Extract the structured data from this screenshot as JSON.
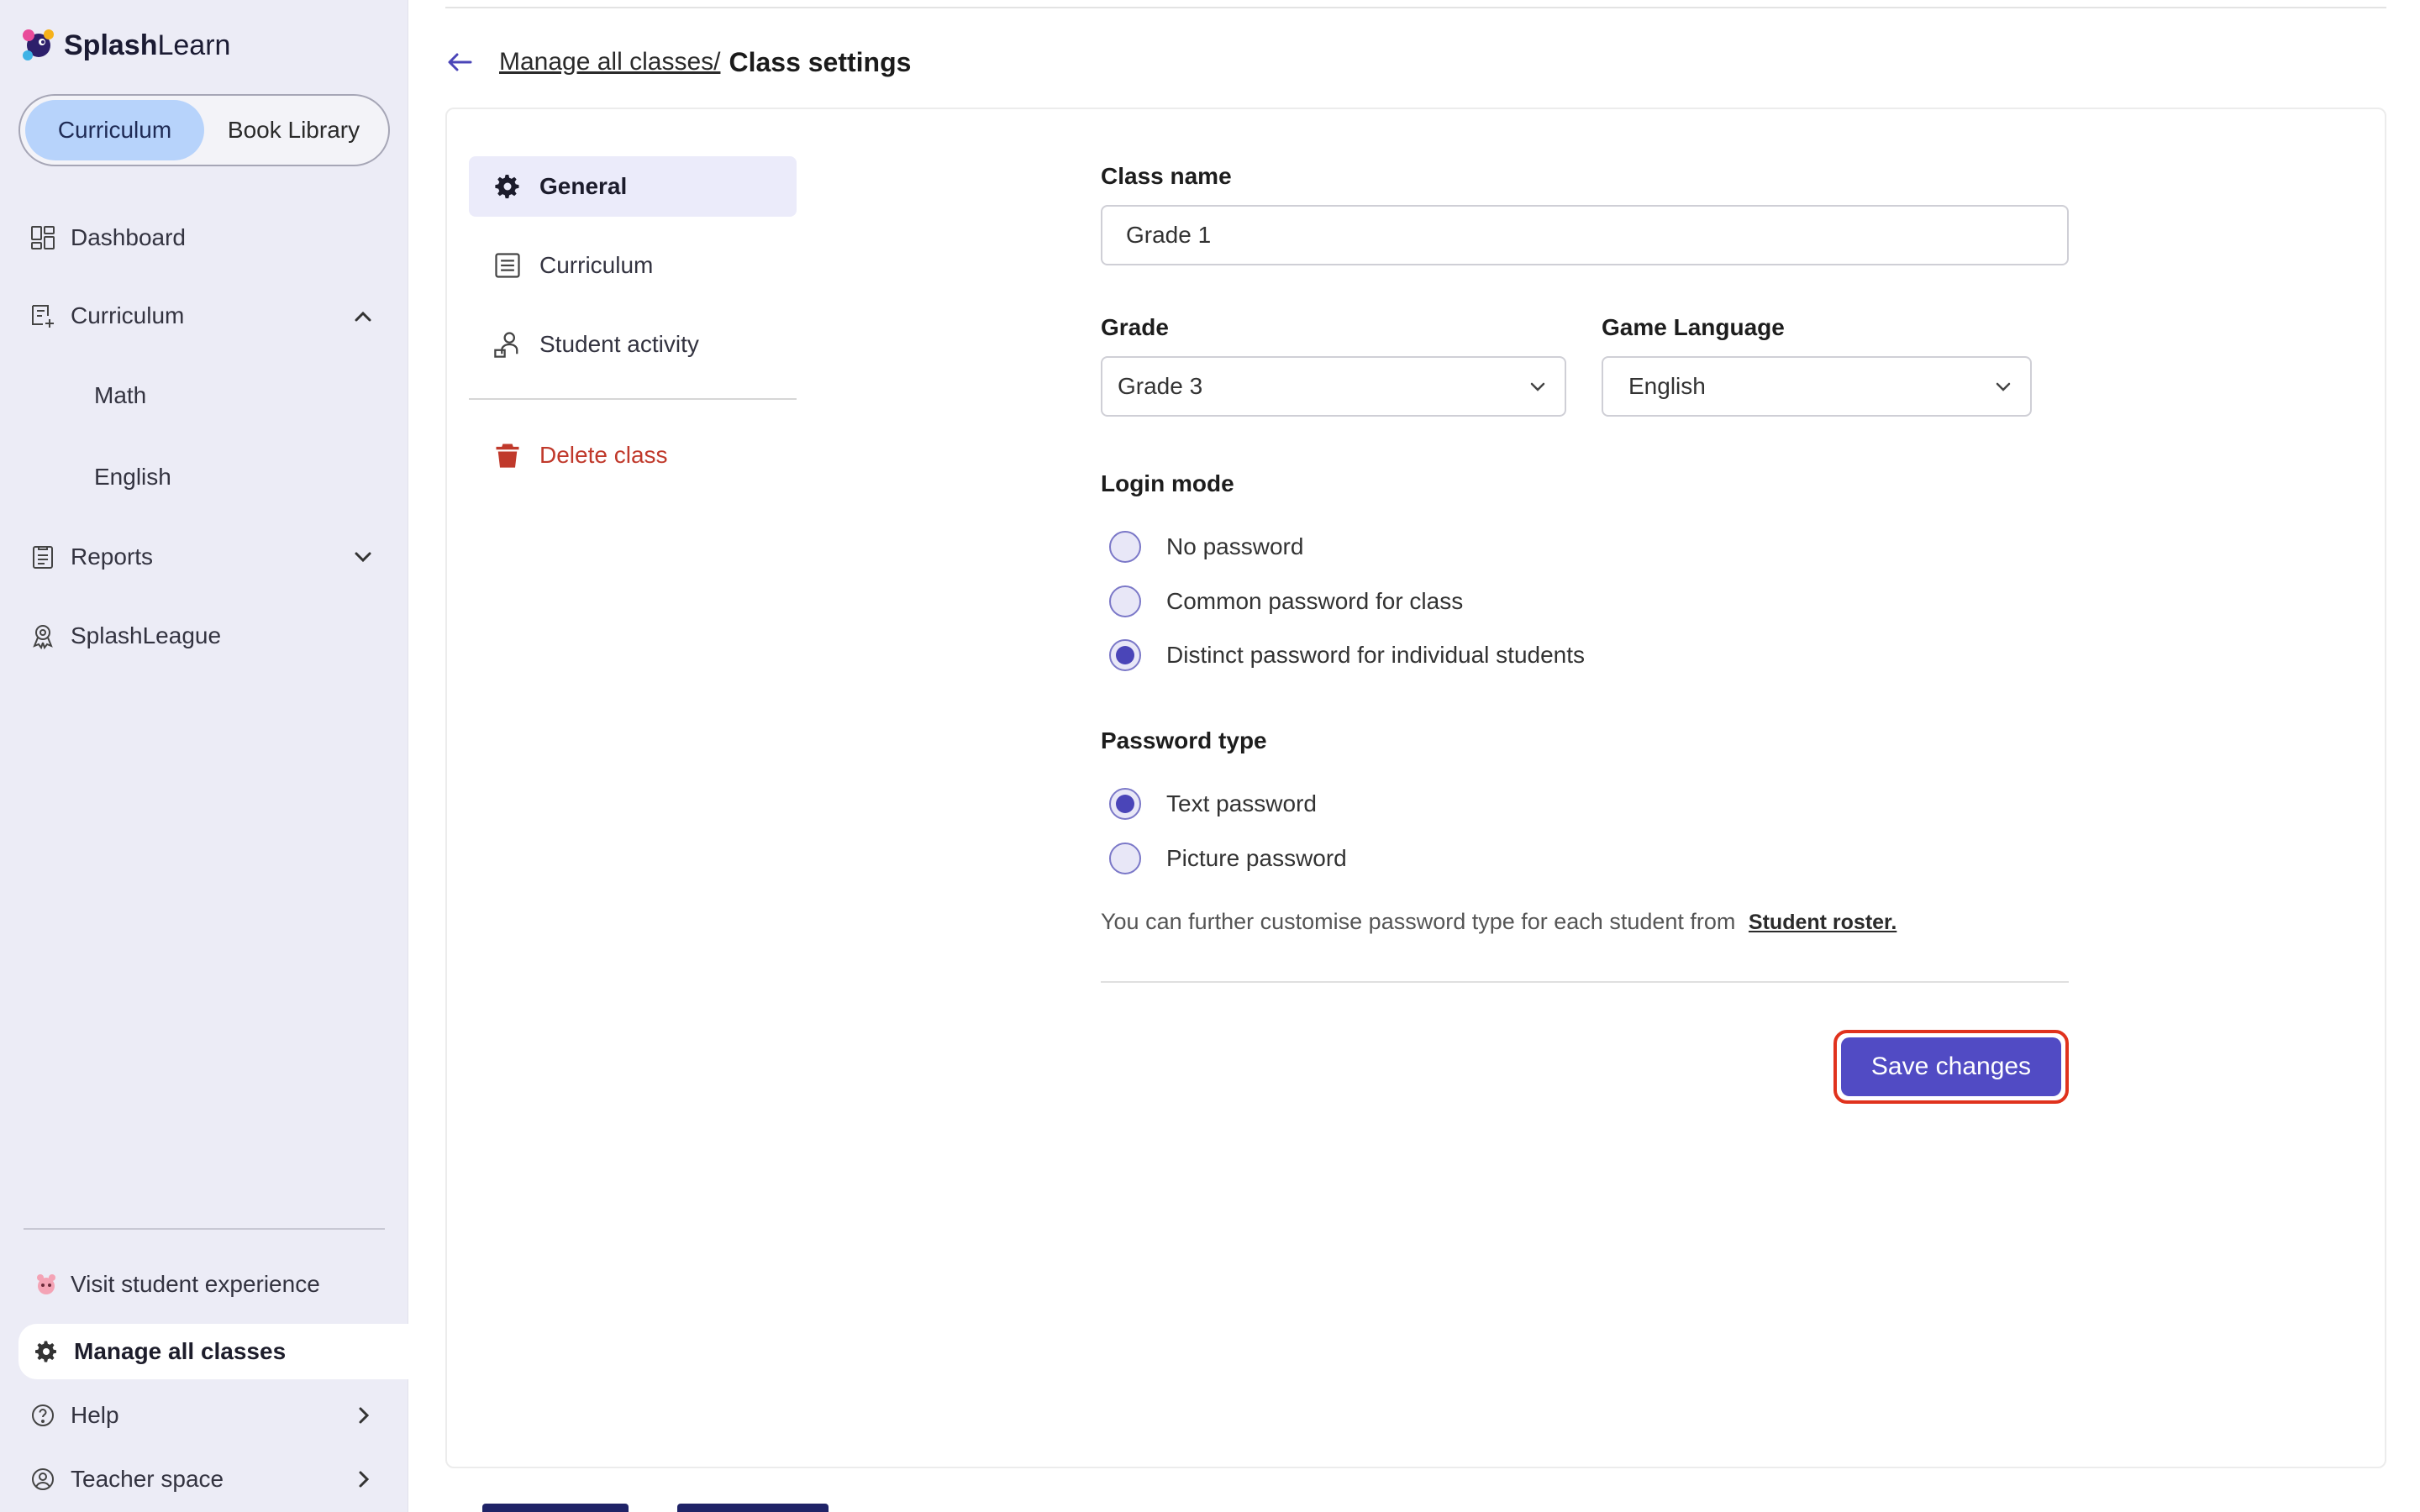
{
  "brand": {
    "name_bold": "Splash",
    "name_light": "Learn"
  },
  "segment": {
    "active": "Curriculum",
    "other": "Book Library"
  },
  "nav": {
    "dashboard": "Dashboard",
    "curriculum": "Curriculum",
    "math": "Math",
    "english": "English",
    "reports": "Reports",
    "splashleague": "SplashLeague",
    "visit_student": "Visit student experience",
    "manage_classes": "Manage all classes",
    "help": "Help",
    "teacher_space": "Teacher space"
  },
  "breadcrumb": {
    "parent": "Manage all classes/",
    "current": "Class settings"
  },
  "tabs": {
    "general": "General",
    "curriculum": "Curriculum",
    "student_activity": "Student activity",
    "delete": "Delete class"
  },
  "form": {
    "class_name_label": "Class name",
    "class_name_value": "Grade 1",
    "grade_label": "Grade",
    "grade_value": "Grade 3",
    "language_label": "Game Language",
    "language_value": "English",
    "login_mode_label": "Login mode",
    "login_modes": [
      "No password",
      "Common password for class",
      "Distinct password for individual students"
    ],
    "login_mode_selected": "Distinct password for individual students",
    "password_type_label": "Password type",
    "password_types": [
      "Text password",
      "Picture password"
    ],
    "password_type_selected": "Text password",
    "hint": "You can further customise password type for each student from",
    "hint_link": "Student roster.",
    "save": "Save changes"
  },
  "colors": {
    "accent": "#514bc4",
    "sidebar": "#ececf6",
    "highlight": "#e0321d",
    "danger": "#c0392b"
  }
}
